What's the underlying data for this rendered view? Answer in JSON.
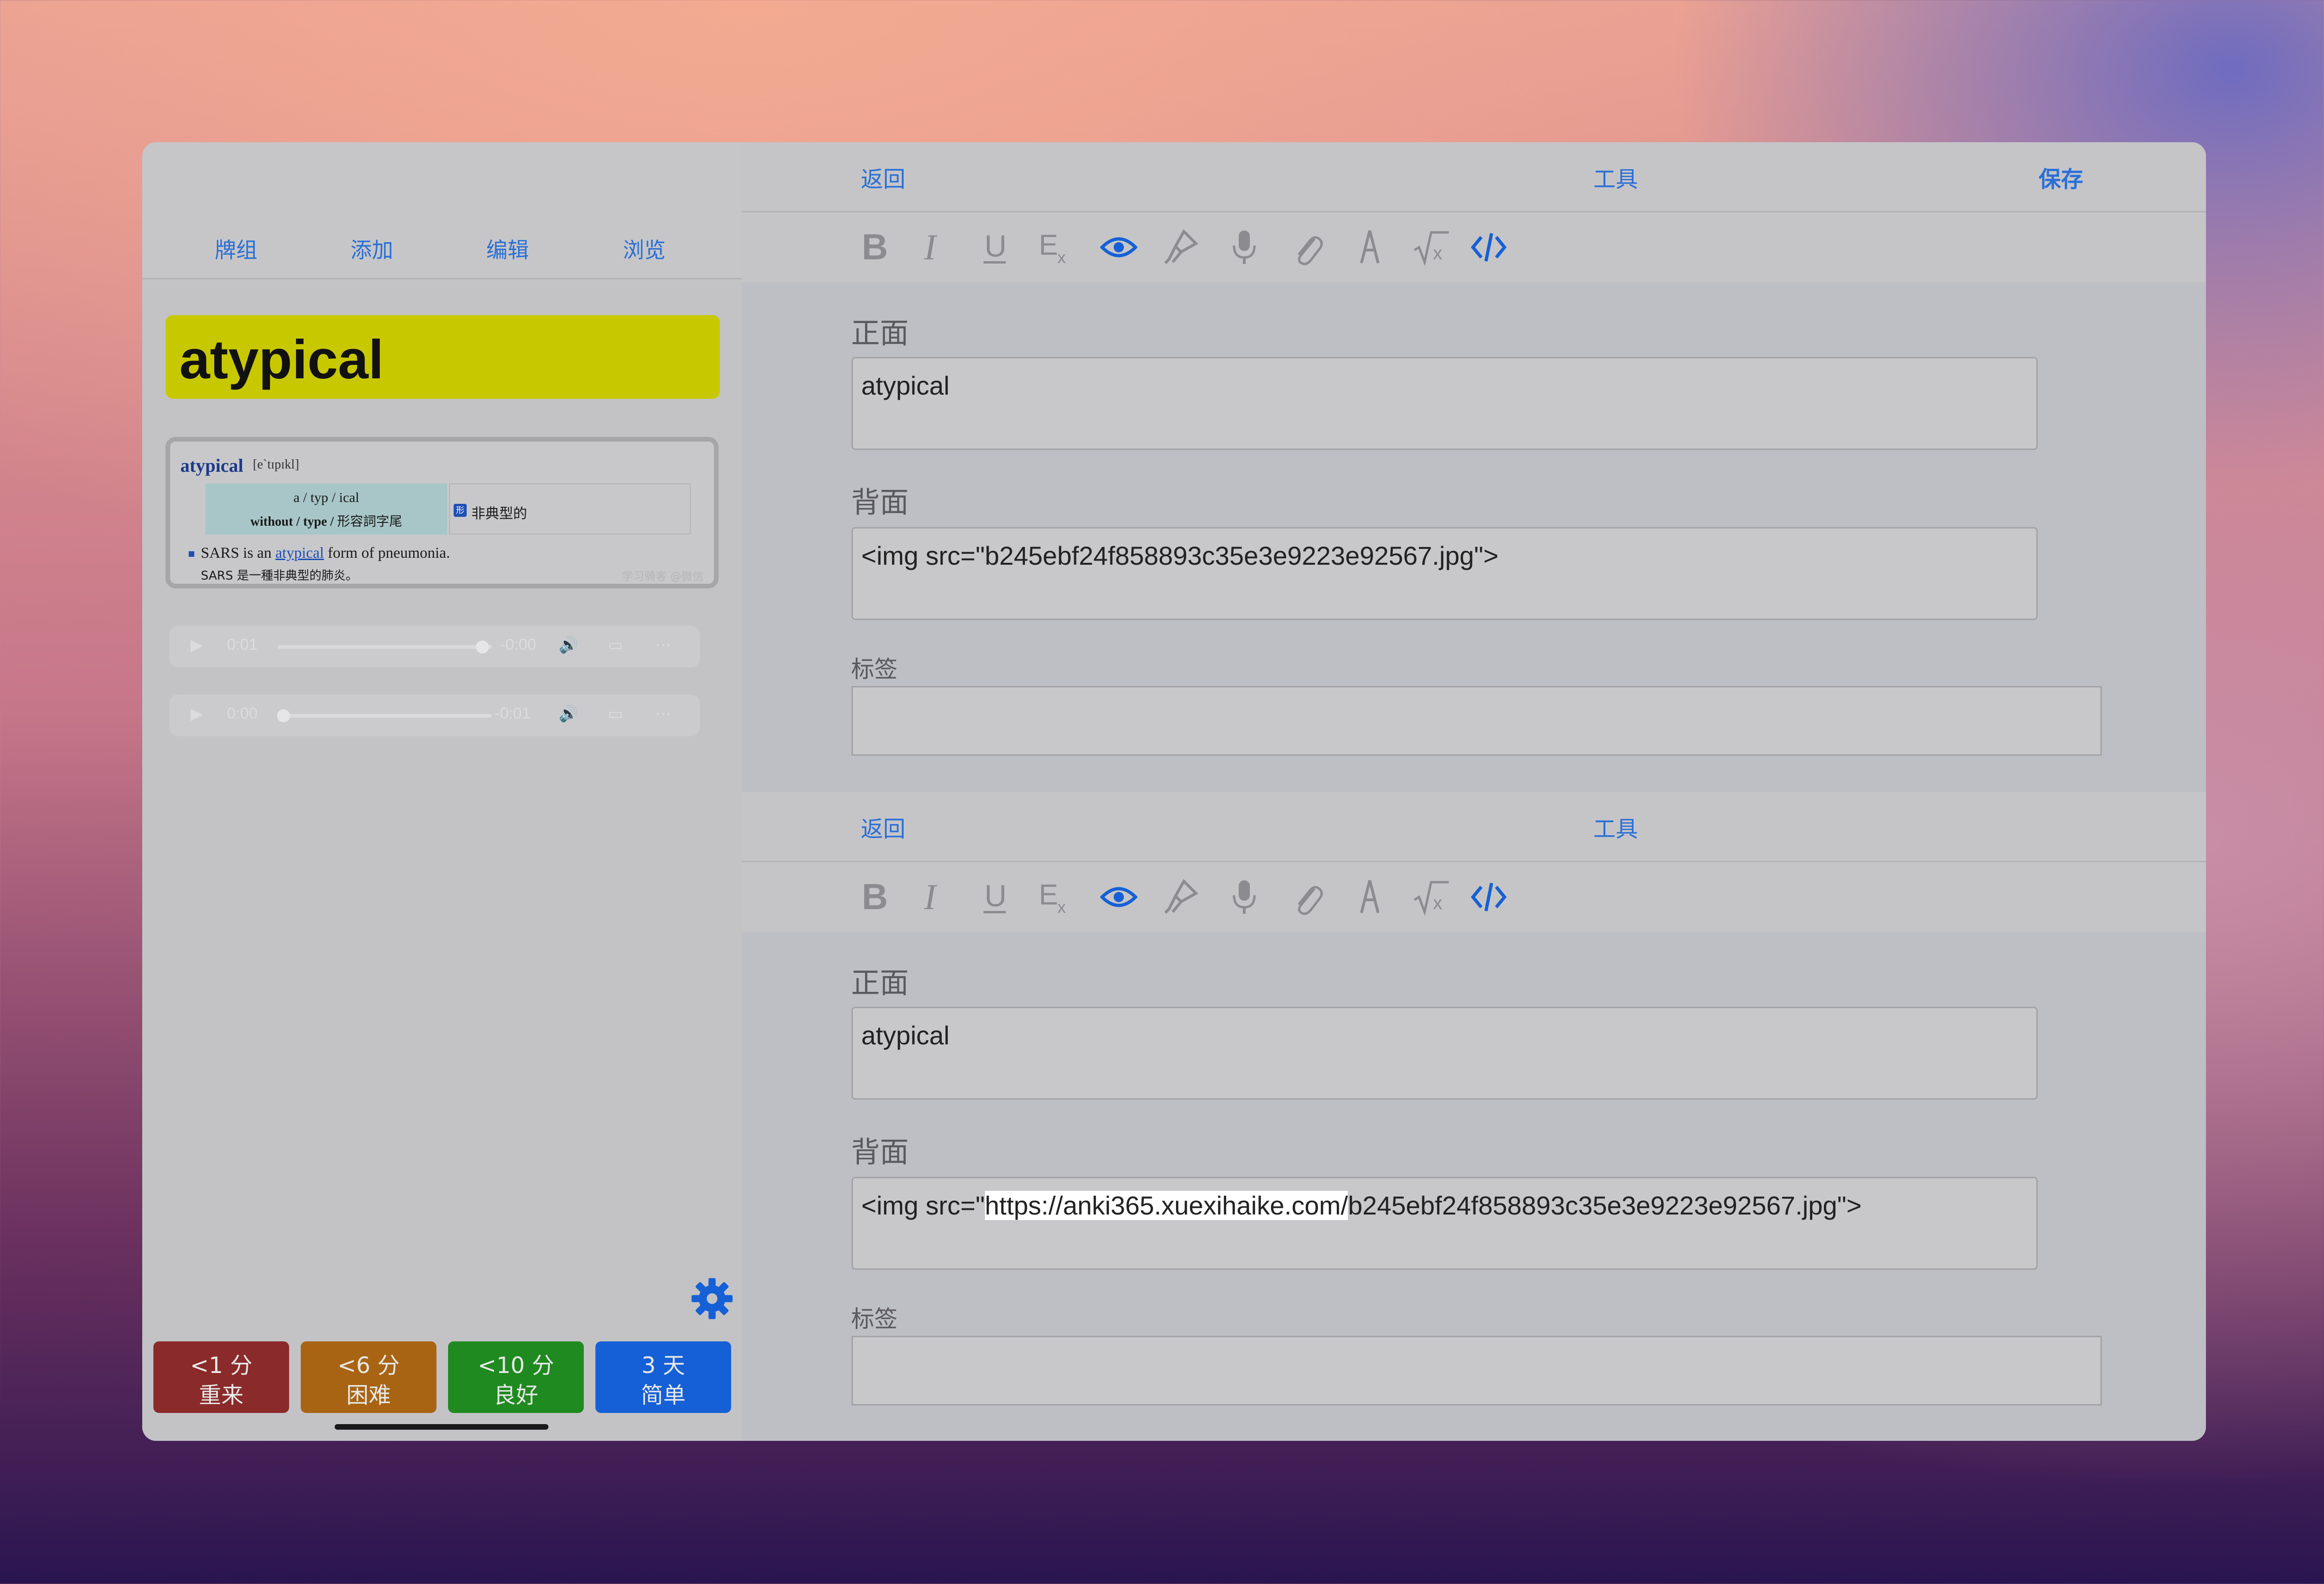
{
  "left": {
    "nav": [
      "牌组",
      "添加",
      "编辑",
      "浏览"
    ],
    "word": "atypical",
    "dict": {
      "headword": "atypical",
      "pronunciation": "[e`tɪpɪkl]",
      "syllables_1a": "a / typ / ical",
      "syllables_2a": "without / type /",
      "syllables_2b": "形容詞字尾",
      "badge": "形",
      "meaning": "非典型的",
      "example_pre": "SARS is an",
      "example_kw": "atypical",
      "example_post": "form of pneumonia.",
      "example_zh": "SARS 是一種非典型的肺炎。",
      "watermark": "学习骑客 @微信"
    },
    "player1": {
      "elapsed": "0:01",
      "remaining": "-0:00",
      "progress": 0.95
    },
    "player2": {
      "elapsed": "0:00",
      "remaining": "-0:01",
      "progress": 0.0
    },
    "answers": [
      {
        "time": "<1 分",
        "label": "重来",
        "color": "#8b2a2a"
      },
      {
        "time": "<6 分",
        "label": "困难",
        "color": "#a86412"
      },
      {
        "time": "<10 分",
        "label": "良好",
        "color": "#1f8a1f"
      },
      {
        "time": "3 天",
        "label": "简单",
        "color": "#1560d6"
      }
    ]
  },
  "editor1": {
    "back": "返回",
    "tools": "工具",
    "save": "保存",
    "front_label": "正面",
    "front_value": "atypical",
    "back_label": "背面",
    "back_value": "<img src=\"b245ebf24f858893c35e3e9223e92567.jpg\">",
    "tags_label": "标签"
  },
  "editor2": {
    "back": "返回",
    "tools": "工具",
    "front_label": "正面",
    "front_value": "atypical",
    "back_label": "背面",
    "back_value_pre": "<img src=\"",
    "back_value_hl": "https://anki365.xuexihaike.com/",
    "back_value_post": "b245ebf24f858893c35e3e9223e92567.jpg\">",
    "tags_label": "标签"
  },
  "toolbar_icons": [
    "bold-icon",
    "italic-icon",
    "underline-icon",
    "clear-format-icon",
    "eye-icon",
    "highlighter-icon",
    "microphone-icon",
    "paperclip-icon",
    "pen-icon",
    "math-icon",
    "code-icon"
  ],
  "colors": {
    "accent": "#2a6fd6",
    "word_bg": "#c8c800"
  }
}
